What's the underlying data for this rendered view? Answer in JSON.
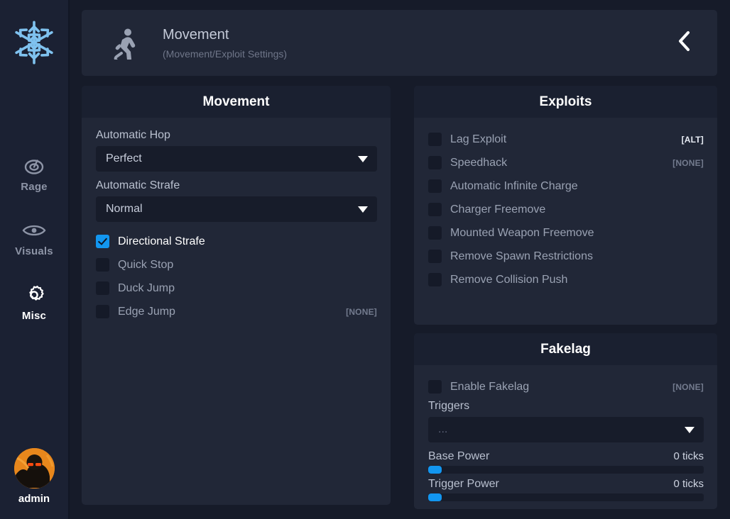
{
  "sidebar": {
    "logo_icon": "snowflake-icon",
    "items": [
      {
        "label": "Rage",
        "icon": "rage-target-icon",
        "active": false
      },
      {
        "label": "Visuals",
        "icon": "eye-icon",
        "active": false
      },
      {
        "label": "Misc",
        "icon": "gear-icon",
        "active": true
      }
    ],
    "user": {
      "name": "admin",
      "avatar_icon": "user-avatar"
    }
  },
  "header": {
    "icon": "running-person-icon",
    "title": "Movement",
    "subtitle": "(Movement/Exploit Settings)",
    "back_icon": "chevron-left-icon"
  },
  "movement": {
    "title": "Movement",
    "fields": [
      {
        "label": "Automatic Hop",
        "value": "Perfect"
      },
      {
        "label": "Automatic Strafe",
        "value": "Normal"
      }
    ],
    "checkboxes": [
      {
        "label": "Directional Strafe",
        "checked": true,
        "keybind": ""
      },
      {
        "label": "Quick Stop",
        "checked": false,
        "keybind": ""
      },
      {
        "label": "Duck Jump",
        "checked": false,
        "keybind": ""
      },
      {
        "label": "Edge Jump",
        "checked": false,
        "keybind": "[NONE]"
      }
    ]
  },
  "exploits": {
    "title": "Exploits",
    "checkboxes": [
      {
        "label": "Lag Exploit",
        "checked": false,
        "keybind": "[ALT]",
        "bound": true
      },
      {
        "label": "Speedhack",
        "checked": false,
        "keybind": "[NONE]",
        "bound": false
      },
      {
        "label": "Automatic Infinite Charge",
        "checked": false,
        "keybind": "",
        "bound": false
      },
      {
        "label": "Charger Freemove",
        "checked": false,
        "keybind": "",
        "bound": false
      },
      {
        "label": "Mounted Weapon Freemove",
        "checked": false,
        "keybind": "",
        "bound": false
      },
      {
        "label": "Remove Spawn Restrictions",
        "checked": false,
        "keybind": "",
        "bound": false
      },
      {
        "label": "Remove Collision Push",
        "checked": false,
        "keybind": "",
        "bound": false
      }
    ]
  },
  "fakelag": {
    "title": "Fakelag",
    "enable": {
      "label": "Enable Fakelag",
      "checked": false,
      "keybind": "[NONE]"
    },
    "triggers": {
      "label": "Triggers",
      "value": "..."
    },
    "sliders": [
      {
        "label": "Base Power",
        "value": "0 ticks",
        "percent": 5
      },
      {
        "label": "Trigger Power",
        "value": "0 ticks",
        "percent": 5
      }
    ]
  },
  "colors": {
    "accent": "#1296f0",
    "panel": "#212737",
    "panel_header": "#1a2030",
    "background": "#161b29",
    "sidebar": "#1b2133",
    "avatar": "#e8871c"
  }
}
